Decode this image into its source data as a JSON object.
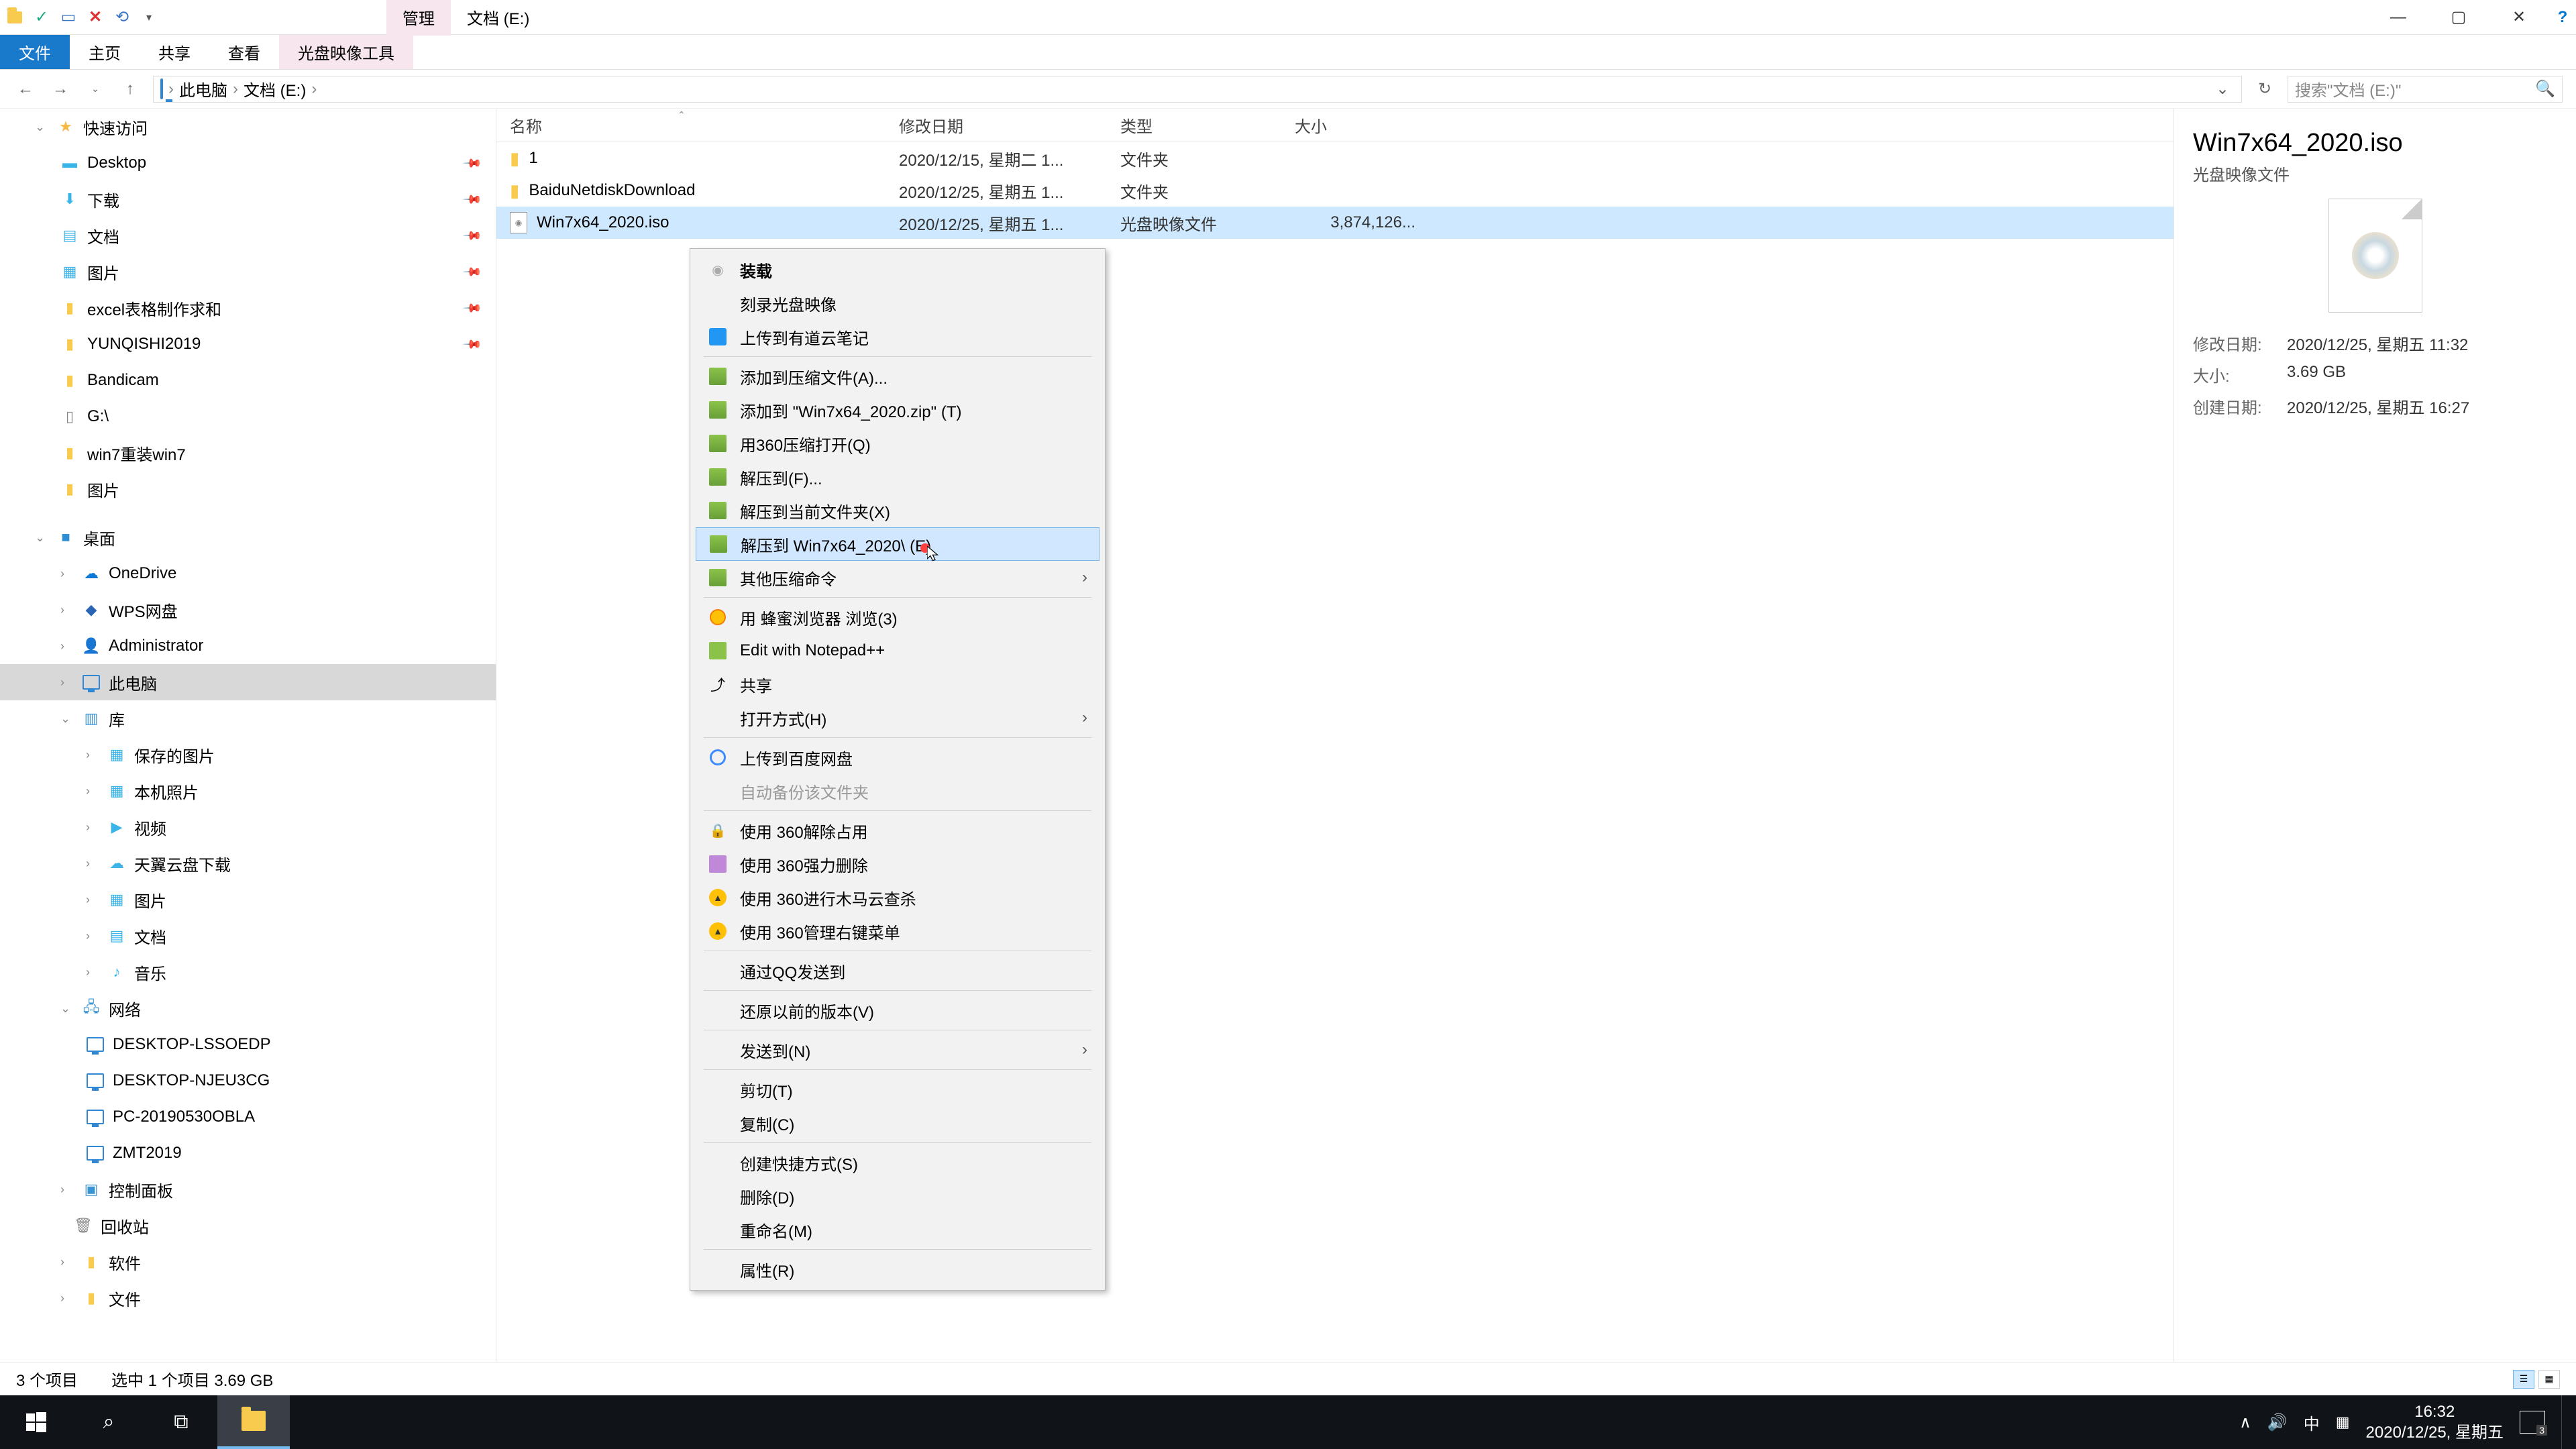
{
  "titlebar": {
    "tab_manage": "管理",
    "tab_location": "文档 (E:)"
  },
  "window_controls": {
    "min": "—",
    "max": "▢",
    "close": "✕",
    "help": "?"
  },
  "ribbon": {
    "file": "文件",
    "home": "主页",
    "share": "共享",
    "view": "查看",
    "disc_tools": "光盘映像工具"
  },
  "address": {
    "back": "←",
    "forward": "→",
    "up": "↑",
    "pc": "此电脑",
    "loc": "文档 (E:)",
    "dropdown": "⌄",
    "refresh": "↻"
  },
  "search": {
    "placeholder": "搜索\"文档 (E:)\"",
    "icon": "🔍"
  },
  "nav": {
    "quick_access": "快速访问",
    "desktop": "Desktop",
    "downloads": "下载",
    "documents": "文档",
    "pictures2": "图片",
    "excel": "excel表格制作求和",
    "yunqishi": "YUNQISHI2019",
    "bandicam": "Bandicam",
    "gdrive": "G:\\",
    "win7": "win7重装win7",
    "pics": "图片",
    "desktop_h": "桌面",
    "onedrive": "OneDrive",
    "wps": "WPS网盘",
    "admin": "Administrator",
    "thispc": "此电脑",
    "libs": "库",
    "saved_pics": "保存的图片",
    "local_pics": "本机照片",
    "video": "视频",
    "tianyi": "天翼云盘下载",
    "pics3": "图片",
    "docs2": "文档",
    "music": "音乐",
    "network": "网络",
    "pc1": "DESKTOP-LSSOEDP",
    "pc2": "DESKTOP-NJEU3CG",
    "pc3": "PC-20190530OBLA",
    "pc4": "ZMT2019",
    "controlpanel": "控制面板",
    "recycle": "回收站",
    "software": "软件",
    "files": "文件"
  },
  "columns": {
    "name": "名称",
    "date": "修改日期",
    "type": "类型",
    "size": "大小"
  },
  "files": [
    {
      "name": "1",
      "date": "2020/12/15, 星期二 1...",
      "type": "文件夹",
      "size": ""
    },
    {
      "name": "BaiduNetdiskDownload",
      "date": "2020/12/25, 星期五 1...",
      "type": "文件夹",
      "size": ""
    },
    {
      "name": "Win7x64_2020.iso",
      "date": "2020/12/25, 星期五 1...",
      "type": "光盘映像文件",
      "size": "3,874,126..."
    }
  ],
  "context_menu": {
    "mount": "装载",
    "burn": "刻录光盘映像",
    "youdao": "上传到有道云笔记",
    "add_archive": "添加到压缩文件(A)...",
    "add_zip": "添加到 \"Win7x64_2020.zip\" (T)",
    "open_360": "用360压缩打开(Q)",
    "extract_to": "解压到(F)...",
    "extract_here": "解压到当前文件夹(X)",
    "extract_named": "解压到 Win7x64_2020\\ (E)",
    "other_compress": "其他压缩命令",
    "bee_browser": "用 蜂蜜浏览器 浏览(3)",
    "notepad": "Edit with Notepad++",
    "share": "共享",
    "open_with": "打开方式(H)",
    "baidu_upload": "上传到百度网盘",
    "auto_backup": "自动备份该文件夹",
    "unlock_360": "使用 360解除占用",
    "force_del": "使用 360强力删除",
    "trojan": "使用 360进行木马云查杀",
    "manage_menu": "使用 360管理右键菜单",
    "qq_send": "通过QQ发送到",
    "restore": "还原以前的版本(V)",
    "send_to": "发送到(N)",
    "cut": "剪切(T)",
    "copy": "复制(C)",
    "shortcut": "创建快捷方式(S)",
    "delete": "删除(D)",
    "rename": "重命名(M)",
    "props": "属性(R)"
  },
  "details": {
    "title": "Win7x64_2020.iso",
    "subtitle": "光盘映像文件",
    "mod_label": "修改日期:",
    "mod_val": "2020/12/25, 星期五 11:32",
    "size_label": "大小:",
    "size_val": "3.69 GB",
    "create_label": "创建日期:",
    "create_val": "2020/12/25, 星期五 16:27"
  },
  "status": {
    "count": "3 个项目",
    "selection": "选中 1 个项目  3.69 GB"
  },
  "taskbar": {
    "ime": "中",
    "time": "16:32",
    "date": "2020/12/25, 星期五",
    "badge": "3",
    "chevron": "∧",
    "volume": "🔊"
  }
}
